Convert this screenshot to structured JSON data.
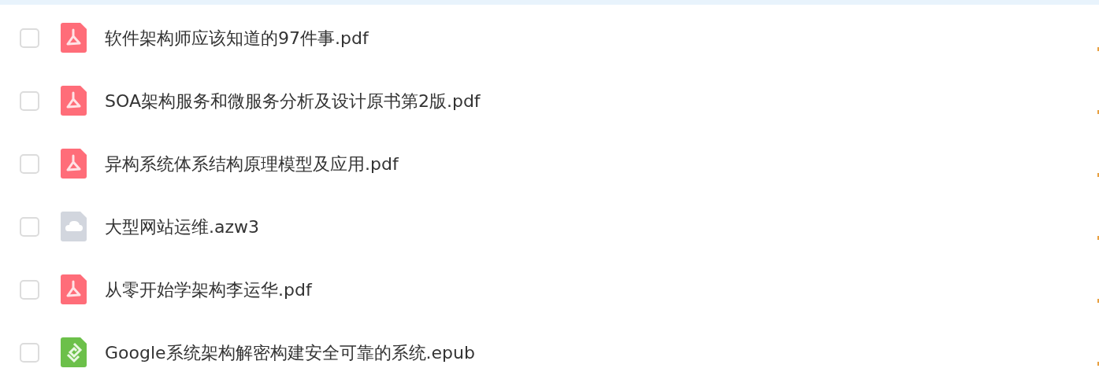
{
  "files": [
    {
      "name": "软件架构师应该知道的97件事.pdf",
      "kind": "pdf",
      "checked": false
    },
    {
      "name": "SOA架构服务和微服务分析及设计原书第2版.pdf",
      "kind": "pdf",
      "checked": false
    },
    {
      "name": "异构系统体系结构原理模型及应用.pdf",
      "kind": "pdf",
      "checked": false
    },
    {
      "name": "大型网站运维.azw3",
      "kind": "cloud",
      "checked": false
    },
    {
      "name": "从零开始学架构李运华.pdf",
      "kind": "pdf",
      "checked": false
    },
    {
      "name": "Google系统架构解密构建安全可靠的系统.epub",
      "kind": "epub",
      "checked": false
    }
  ]
}
